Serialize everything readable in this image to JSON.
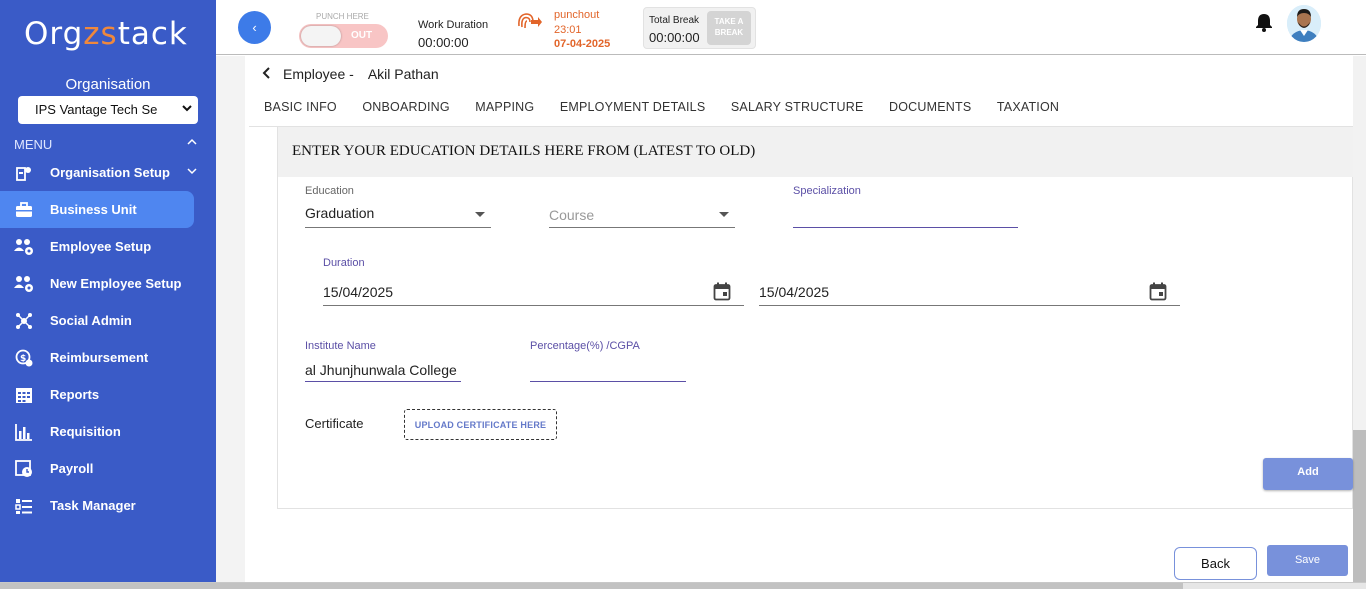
{
  "sidebar": {
    "logo_main": "Org",
    "logo_accent": "zs",
    "logo_tail": "tack",
    "org_label": "Organisation",
    "org_selected": "IPS Vantage Tech Se",
    "menu_label": "MENU",
    "items": [
      {
        "label": "Organisation Setup",
        "icon": "org-setup-icon"
      },
      {
        "label": "Business Unit",
        "icon": "briefcase-icon",
        "active": true
      },
      {
        "label": "Employee Setup",
        "icon": "people-gear-icon"
      },
      {
        "label": "New Employee Setup",
        "icon": "people-gear-icon"
      },
      {
        "label": "Social Admin",
        "icon": "network-icon"
      },
      {
        "label": "Reimbursement",
        "icon": "reimbursement-icon"
      },
      {
        "label": "Reports",
        "icon": "calendar-grid-icon"
      },
      {
        "label": "Requisition",
        "icon": "bar-chart-icon"
      },
      {
        "label": "Payroll",
        "icon": "payroll-icon"
      },
      {
        "label": "Task Manager",
        "icon": "task-list-icon"
      }
    ]
  },
  "topbar": {
    "collapse_glyph": "‹",
    "punch_label": "PUNCH HERE",
    "punch_state": "OUT",
    "work_duration_label": "Work Duration",
    "work_duration_value": "00:00:00",
    "punchout_label": "punchout",
    "punchout_time": "23:01",
    "punchout_date": "07-04-2025",
    "total_break_label": "Total Break",
    "total_break_value": "00:00:00",
    "take_break_line1": "TAKE A",
    "take_break_line2": "BREAK"
  },
  "breadcrumb": {
    "section": "Employee -",
    "employee_name": "Akil Pathan"
  },
  "tabs": [
    "BASIC INFO",
    "ONBOARDING",
    "MAPPING",
    "EMPLOYMENT DETAILS",
    "SALARY STRUCTURE",
    "DOCUMENTS",
    "TAXATION"
  ],
  "education": {
    "section_title": "ENTER YOUR EDUCATION DETAILS HERE FROM (LATEST TO OLD)",
    "education_label": "Education",
    "education_value": "Graduation",
    "course_placeholder": "Course",
    "specialization_label": "Specialization",
    "duration_label": "Duration",
    "duration_from": "15/04/2025",
    "duration_to": "15/04/2025",
    "institute_label": "Institute Name",
    "institute_value": "al Jhunjhunwala College",
    "percentage_label": "Percentage(%) /CGPA",
    "certificate_label": "Certificate",
    "upload_label": "UPLOAD CERTIFICATE HERE",
    "add_label": "Add"
  },
  "footer": {
    "back_label": "Back",
    "save_label": "Save"
  },
  "colors": {
    "sidebar_bg": "#3a5bc7",
    "active_item": "#4f86f0",
    "accent_orange": "#e2652a",
    "button_blue": "#7891db",
    "label_purple": "#5b4fa6"
  }
}
